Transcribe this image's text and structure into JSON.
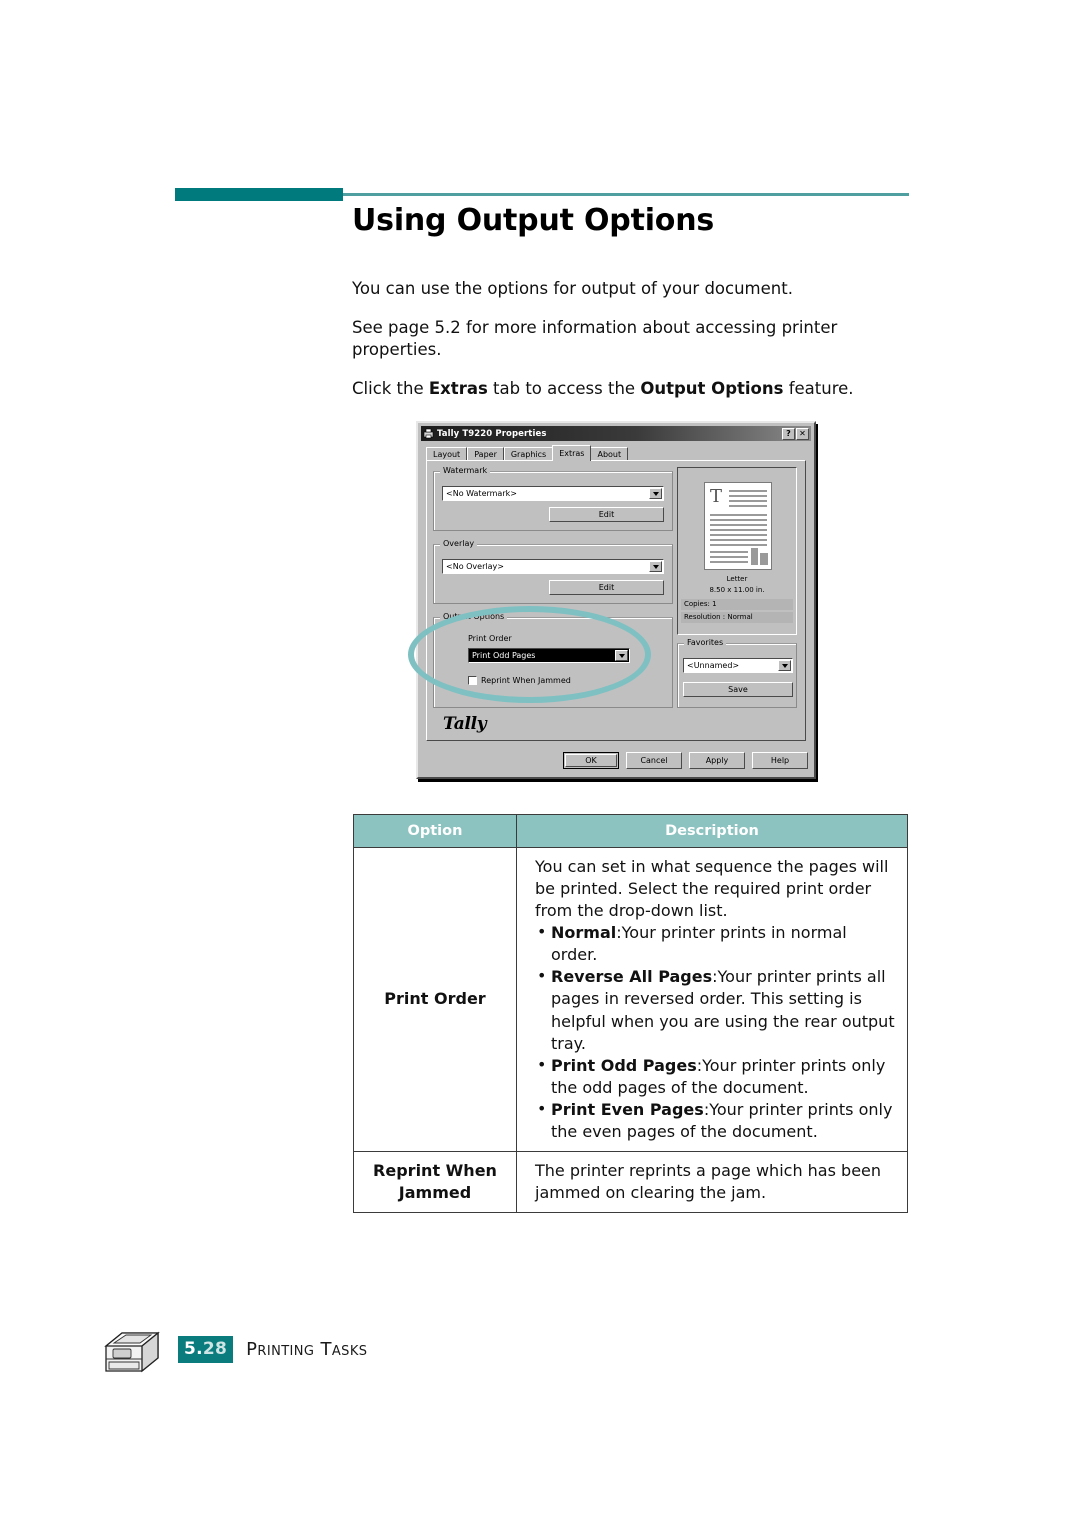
{
  "header": {
    "title": "Using Output Options"
  },
  "body": {
    "paragraphs": [
      {
        "text": "You can use the options for output of your document."
      },
      {
        "text": "See page 5.2 for more information about accessing printer properties."
      }
    ],
    "instruction": {
      "pre": "Click the ",
      "bold1": "Extras",
      "mid": " tab to access the ",
      "bold2": "Output Options",
      "post": " feature."
    }
  },
  "dialog": {
    "title": "Tally T9220 Properties",
    "title_buttons": {
      "help": "?",
      "close": "✕"
    },
    "tabs": [
      {
        "label": "Layout",
        "active": false
      },
      {
        "label": "Paper",
        "active": false
      },
      {
        "label": "Graphics",
        "active": false
      },
      {
        "label": "Extras",
        "active": true
      },
      {
        "label": "About",
        "active": false
      }
    ],
    "watermark": {
      "group_label": "Watermark",
      "combo_value": "<No Watermark>",
      "edit_button": "Edit"
    },
    "overlay": {
      "group_label": "Overlay",
      "combo_value": "<No Overlay>",
      "edit_button": "Edit"
    },
    "output_options": {
      "group_label": "Output Options",
      "print_order_label": "Print Order",
      "print_order_value": "Print Odd Pages",
      "reprint_checkbox_label": "Reprint When Jammed",
      "reprint_checked": false
    },
    "preview": {
      "paper_name": "Letter",
      "paper_size": "8.50 x 11.00 in.",
      "copies": "Copies: 1",
      "resolution": "Resolution : Normal",
      "page_glyph": "T"
    },
    "favorites": {
      "group_label": "Favorites",
      "combo_value": "<Unnamed>",
      "save_button": "Save"
    },
    "brand": "Tally",
    "buttons": {
      "ok": "OK",
      "cancel": "Cancel",
      "apply": "Apply",
      "help": "Help"
    }
  },
  "table": {
    "headers": [
      "Option",
      "Description"
    ],
    "rows": [
      {
        "option": "Print Order",
        "intro": "You can set in what sequence the pages will be printed. Select the required print order from the drop-down list.",
        "bullets": [
          {
            "term": "Normal",
            "sep": ":",
            "text": "Your printer prints in normal order."
          },
          {
            "term": "Reverse All Pages",
            "sep": ":",
            "text": "Your printer prints all pages in reversed order. This setting is helpful when you are using the rear output tray."
          },
          {
            "term": "Print Odd Pages",
            "sep": ":",
            "text": "Your printer prints only the odd pages of the document."
          },
          {
            "term": "Print Even Pages",
            "sep": ":",
            "text": "Your printer prints only the even pages of the document."
          }
        ]
      },
      {
        "option": "Reprint When Jammed",
        "intro": "The printer reprints a page which has been jammed on clearing the jam.",
        "bullets": []
      }
    ]
  },
  "footer": {
    "page_major": "5.",
    "page_minor": "28",
    "section": "Printing Tasks"
  },
  "colors": {
    "teal_dark": "#007a7c",
    "teal_rule": "#4f9fa1",
    "teal_table_header": "#8cc3c0",
    "teal_highlight": "#7fc0c2",
    "badge": "#0b7c7e"
  }
}
